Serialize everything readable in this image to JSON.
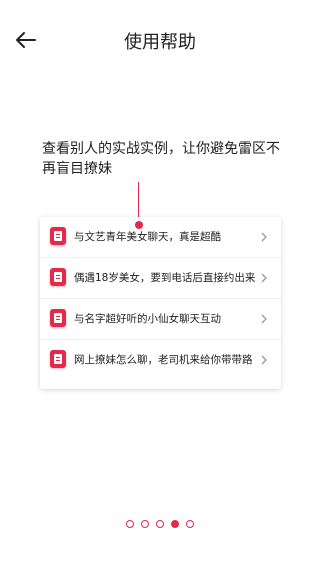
{
  "header": {
    "title": "使用帮助",
    "back_icon": "arrow-left-icon"
  },
  "tip": {
    "text": "查看别人的实战实例，让你避免雷区不再盲目撩妹"
  },
  "list": {
    "items": [
      {
        "icon": "document-icon",
        "label": "与文艺青年美女聊天，真是超酷"
      },
      {
        "icon": "document-icon",
        "label": "偶遇18岁美女，要到电话后直接约出来"
      },
      {
        "icon": "document-icon",
        "label": "与名字超好听的小仙女聊天互动"
      },
      {
        "icon": "document-icon",
        "label": "网上撩妹怎么聊，老司机来给你带带路"
      }
    ]
  },
  "pager": {
    "total": 5,
    "active_index": 3
  },
  "colors": {
    "accent": "#e5294b",
    "text": "#222222",
    "divider": "#efefef"
  }
}
